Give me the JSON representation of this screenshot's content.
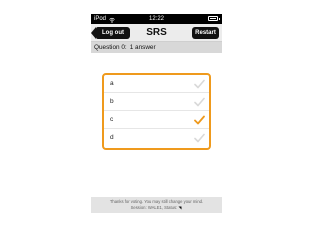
{
  "statusbar": {
    "carrier": "iPod",
    "time": "12:22"
  },
  "navbar": {
    "title": "SRS",
    "logout_label": "Log out",
    "restart_label": "Restart"
  },
  "question": {
    "label": "Question 0:",
    "answers_count": "1 answer"
  },
  "answers": [
    {
      "label": "a",
      "selected": false
    },
    {
      "label": "b",
      "selected": false
    },
    {
      "label": "c",
      "selected": true
    },
    {
      "label": "d",
      "selected": false
    }
  ],
  "footer": {
    "line1": "Thanks for voting. You may still change your mind.",
    "line2": "Session: WALE1, Status:"
  },
  "colors": {
    "accent": "#ef9a1d",
    "check_unselected": "#d9d9d9",
    "check_selected": "#ef9a1d"
  }
}
